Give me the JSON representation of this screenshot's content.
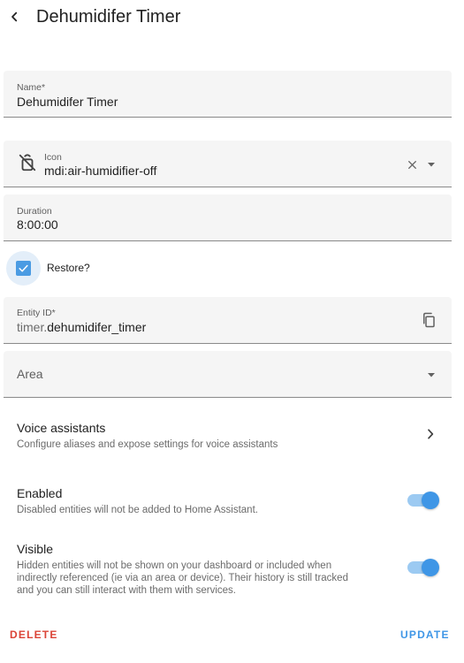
{
  "header": {
    "title": "Dehumidifer Timer"
  },
  "form": {
    "name": {
      "label": "Name*",
      "value": "Dehumidifer Timer"
    },
    "icon": {
      "label": "Icon",
      "value": "mdi:air-humidifier-off",
      "icon_name": "air-humidifier-off-icon"
    },
    "duration": {
      "label": "Duration",
      "value": "8:00:00"
    },
    "restore": {
      "label": "Restore?",
      "checked": true
    },
    "entity_id": {
      "label": "Entity ID*",
      "prefix": "timer.",
      "value": "dehumidifer_timer"
    },
    "area": {
      "placeholder": "Area"
    }
  },
  "voice": {
    "title": "Voice assistants",
    "description": "Configure aliases and expose settings for voice assistants"
  },
  "enabled": {
    "title": "Enabled",
    "description": "Disabled entities will not be added to Home Assistant.",
    "on": true
  },
  "visible": {
    "title": "Visible",
    "description_lines": [
      "Hidden entities will not be shown on your dashboard or included when",
      "indirectly referenced (ie via an area or device). Their history is still tracked",
      "and you can still interact with them with services."
    ],
    "on": true
  },
  "footer": {
    "delete_label": "DELETE",
    "update_label": "UPDATE"
  },
  "colors": {
    "accent": "#3f96e6",
    "delete": "#db4437",
    "field_bg": "#f5f5f5"
  }
}
